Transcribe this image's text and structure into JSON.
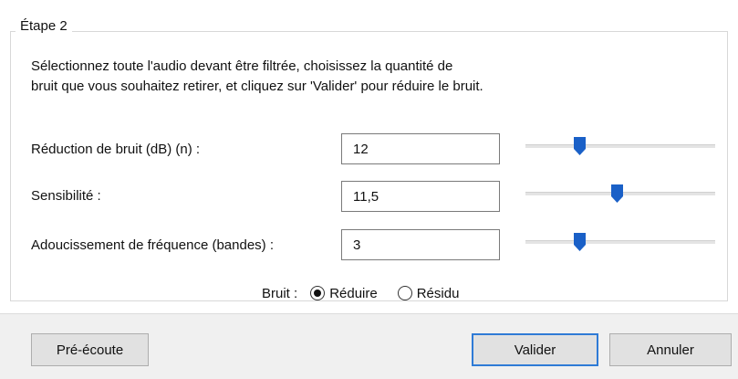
{
  "step": {
    "legend": "Étape 2"
  },
  "instructions": {
    "line1": "Sélectionnez toute l'audio devant être filtrée, choisissez la quantité de",
    "line2": "bruit que vous souhaitez retirer, et cliquez sur 'Valider' pour réduire le bruit."
  },
  "settings": [
    {
      "label": "Réduction de bruit (dB) (n) :",
      "value": "12",
      "slider_position": 0.27
    },
    {
      "label": "Sensibilité :",
      "value": "11,5",
      "slider_position": 0.48
    },
    {
      "label": "Adoucissement de fréquence (bandes) :",
      "value": "3",
      "slider_position": 0.27
    }
  ],
  "noise": {
    "label": "Bruit :",
    "options": [
      {
        "label": "Réduire",
        "selected": true
      },
      {
        "label": "Résidu",
        "selected": false
      }
    ]
  },
  "buttons": {
    "preview": "Pré-écoute",
    "ok": "Valider",
    "cancel": "Annuler"
  },
  "colors": {
    "slider_thumb": "#1a60c7",
    "default_button_border": "#2f7bd6",
    "footer_background": "#f0f0f0"
  }
}
